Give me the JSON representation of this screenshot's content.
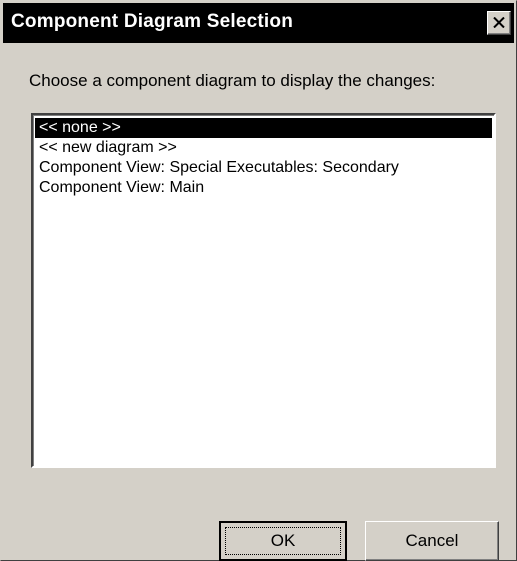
{
  "dialog": {
    "title": "Component Diagram Selection",
    "prompt": "Choose a component diagram to display the changes:"
  },
  "list": {
    "items": [
      {
        "label": "<< none >>",
        "selected": true
      },
      {
        "label": "<< new diagram >>",
        "selected": false
      },
      {
        "label": "Component View: Special Executables: Secondary",
        "selected": false
      },
      {
        "label": "Component View: Main",
        "selected": false
      }
    ]
  },
  "buttons": {
    "ok_label": "OK",
    "cancel_label": "Cancel"
  },
  "icons": {
    "close": "close-icon"
  },
  "colors": {
    "face": "#d4d0c8",
    "title_bar": "#000000",
    "selection": "#000000"
  }
}
